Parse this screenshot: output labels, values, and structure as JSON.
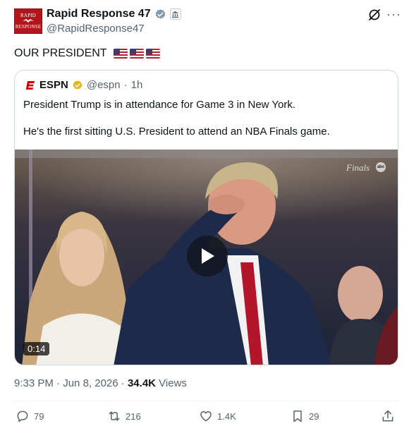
{
  "author": {
    "display_name": "Rapid Response 47",
    "handle": "@RapidResponse47",
    "avatar_text": [
      "RAPID",
      "RESPONSE"
    ],
    "verified_badge": "verified-badge-icon",
    "affiliation_badge": "government-building-icon"
  },
  "tweet": {
    "text": "OUR PRESIDENT",
    "flags": [
      "us-flag",
      "us-flag",
      "us-flag"
    ]
  },
  "quoted": {
    "display_name": "ESPN",
    "handle": "@espn",
    "separator": "·",
    "time": "1h",
    "line1": "President Trump is in attendance for Game 3 in New York.",
    "line2": "He's the first sitting U.S. President to attend an NBA Finals game.",
    "video": {
      "duration": "0:14",
      "watermark": "Finals",
      "network": "abc"
    }
  },
  "meta": {
    "time": "9:33 PM",
    "separator": "·",
    "date": "Jun 8, 2026",
    "views_count": "34.4K",
    "views_label": "Views"
  },
  "actions": {
    "replies": "79",
    "reposts": "216",
    "likes": "1.4K",
    "bookmarks": "29"
  },
  "colors": {
    "text": "#0f1419",
    "muted": "#536471",
    "border": "#cfd9de",
    "verified_blue": "#1d9bf0",
    "verified_gold": "#e2b719",
    "espn_red": "#d00000"
  }
}
